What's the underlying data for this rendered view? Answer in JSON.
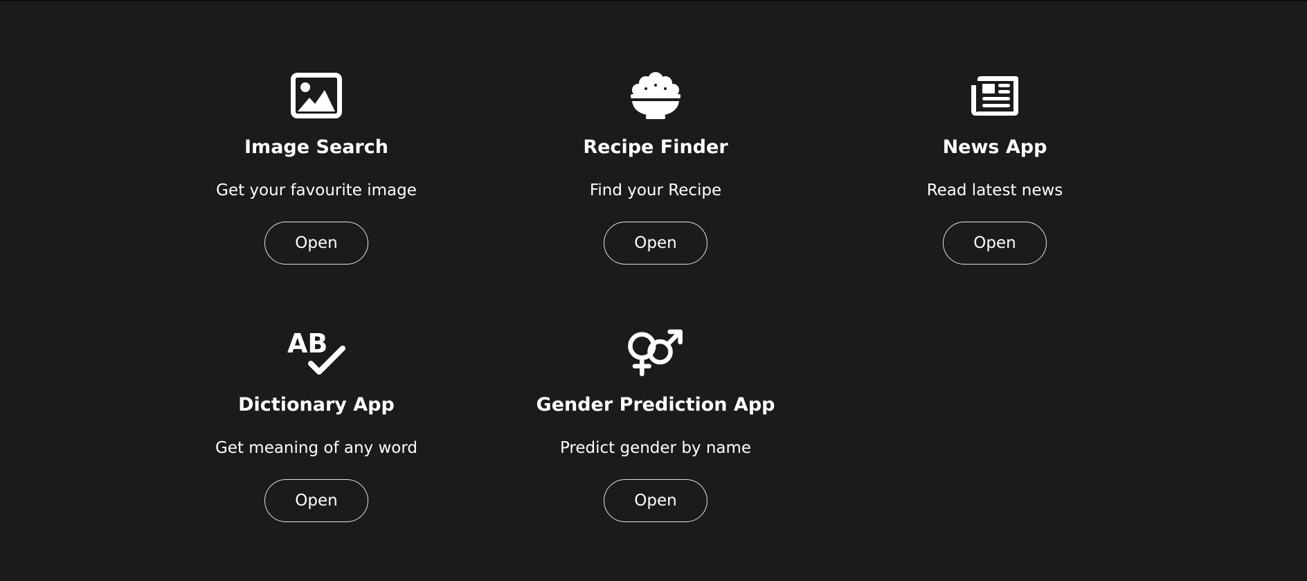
{
  "apps": [
    {
      "icon": "image-icon",
      "title": "Image Search",
      "description": "Get your favourite image",
      "button_label": "Open"
    },
    {
      "icon": "rice-bowl-icon",
      "title": "Recipe Finder",
      "description": "Find your Recipe",
      "button_label": "Open"
    },
    {
      "icon": "newspaper-icon",
      "title": "News App",
      "description": "Read latest news",
      "button_label": "Open"
    },
    {
      "icon": "spell-check-icon",
      "title": "Dictionary App",
      "description": "Get meaning of any word",
      "button_label": "Open"
    },
    {
      "icon": "venus-mars-icon",
      "title": "Gender Prediction App",
      "description": "Predict gender by name",
      "button_label": "Open"
    }
  ],
  "colors": {
    "background": "#1b1b1b",
    "text": "#ffffff",
    "button_border": "#e6e6e6"
  }
}
